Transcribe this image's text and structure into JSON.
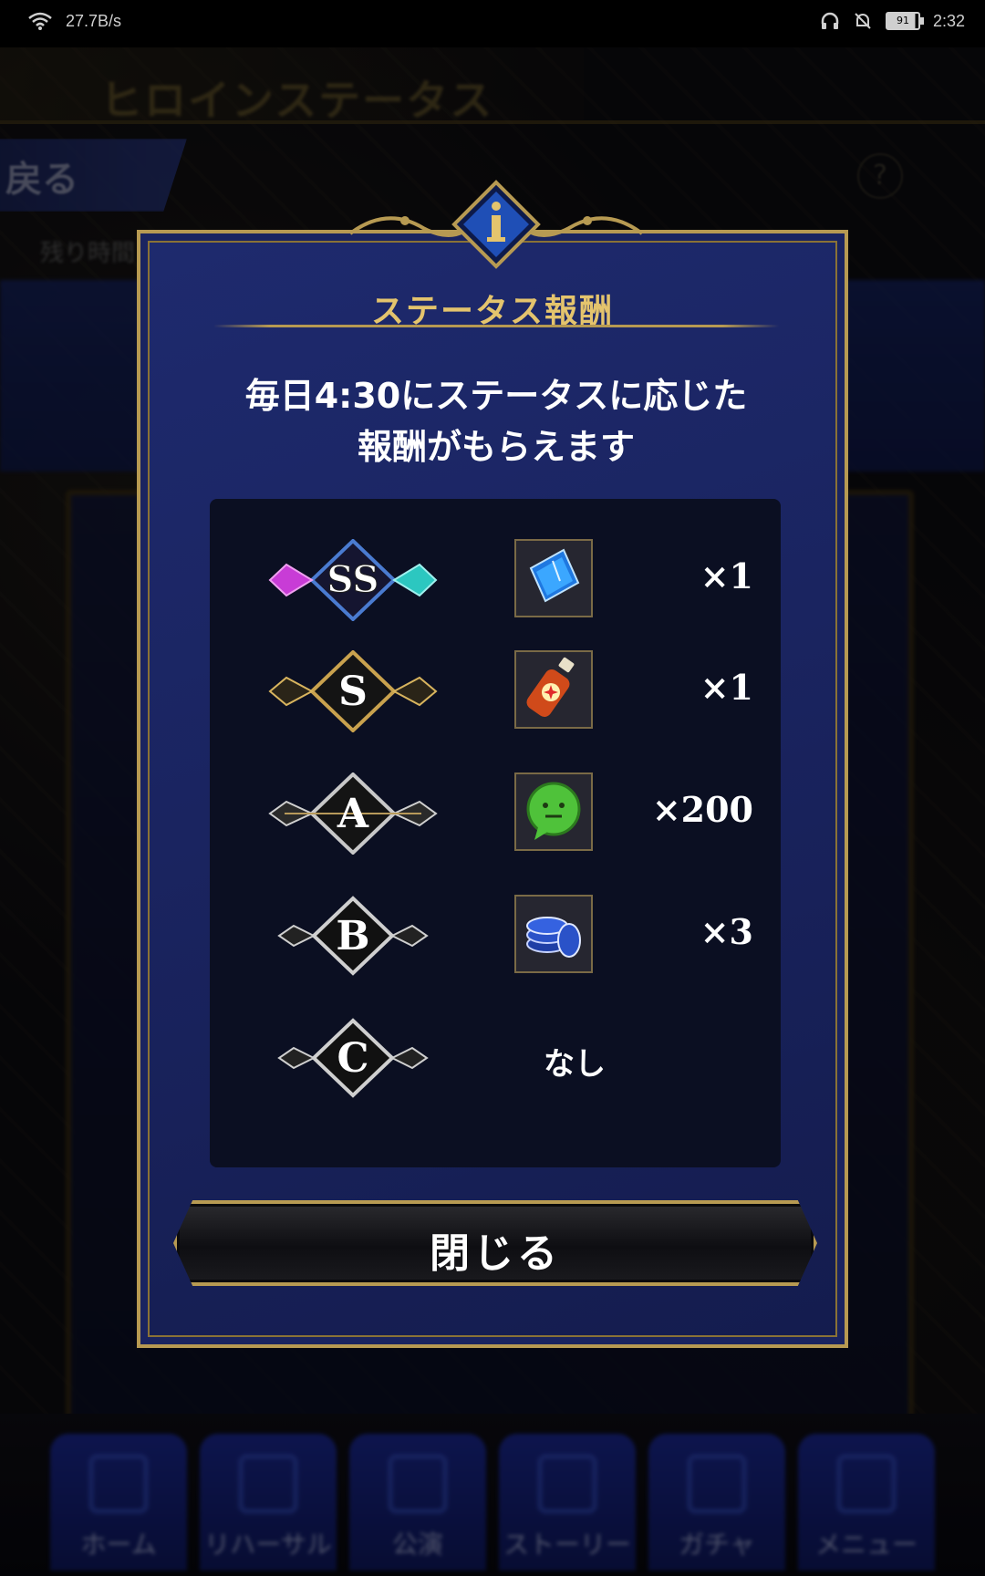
{
  "status_bar": {
    "network_speed": "27.7B/s",
    "battery_level": "91",
    "time": "2:32"
  },
  "background": {
    "page_title": "ヒロインステータス",
    "back_label": "戻る",
    "help_label": "?",
    "remaining_time_label": "残り時間"
  },
  "bottom_nav": [
    {
      "label": "ホーム"
    },
    {
      "label": "リハーサル"
    },
    {
      "label": "公演"
    },
    {
      "label": "ストーリー"
    },
    {
      "label": "ガチャ"
    },
    {
      "label": "メニュー"
    }
  ],
  "modal": {
    "info_icon": "i",
    "title": "ステータス報酬",
    "description_line1": "毎日4:30にステータスに応じた",
    "description_line2": "報酬がもらえます",
    "rewards": [
      {
        "rank": "SS",
        "item_icon": "ticket-icon",
        "quantity": "×1"
      },
      {
        "rank": "S",
        "item_icon": "drink-bottle-icon",
        "quantity": "×1"
      },
      {
        "rank": "A",
        "item_icon": "chat-bubble-icon",
        "quantity": "×200"
      },
      {
        "rank": "B",
        "item_icon": "chips-icon",
        "quantity": "×3"
      },
      {
        "rank": "C",
        "item_icon": "",
        "quantity": "",
        "none_label": "なし"
      }
    ],
    "close_label": "閉じる"
  },
  "colors": {
    "gold": "#b79a52",
    "title_gold": "#e4c46d",
    "modal_blue": "#1a2460",
    "panel_dark": "#0b0f22"
  }
}
